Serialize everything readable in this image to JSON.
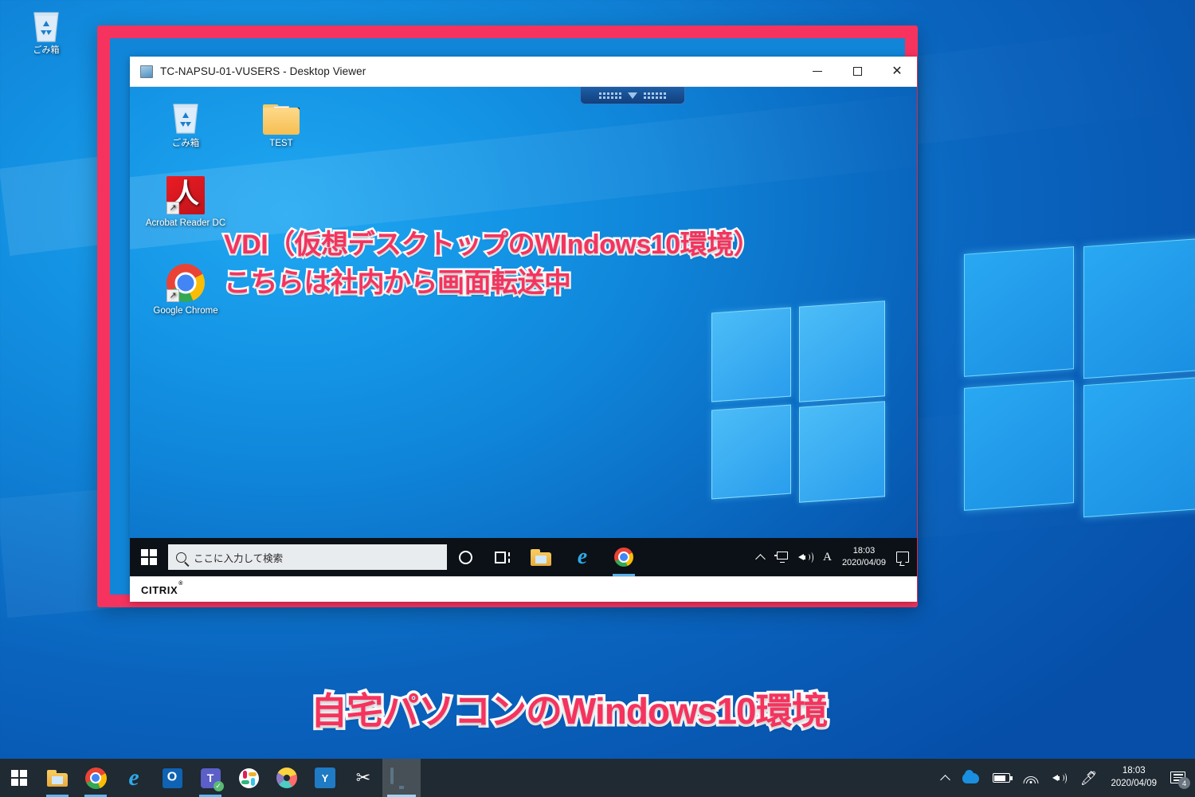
{
  "host": {
    "desktop_icons": [
      {
        "name": "recycle-bin",
        "label": "ごみ箱"
      }
    ],
    "annotation_bottom": "自宅パソコンのWindows10環境",
    "taskbar": {
      "start_label": "Start",
      "apps": [
        {
          "name": "file-explorer",
          "label": "エクスプローラー"
        },
        {
          "name": "google-chrome",
          "label": "Google Chrome"
        },
        {
          "name": "microsoft-edge",
          "label": "Microsoft Edge"
        },
        {
          "name": "microsoft-outlook",
          "label": "Outlook",
          "glyph": "O"
        },
        {
          "name": "microsoft-teams",
          "label": "Microsoft Teams",
          "glyph": "T",
          "badge": "✓"
        },
        {
          "name": "slack",
          "label": "Slack"
        },
        {
          "name": "paint-3d",
          "label": "ペイント 3D"
        },
        {
          "name": "yammer",
          "label": "Yammer",
          "glyph": "Y"
        },
        {
          "name": "snipping-tool",
          "label": "Snipping Tool",
          "glyph": "✂"
        },
        {
          "name": "remote-desktop",
          "label": "Desktop Viewer",
          "active": true
        }
      ],
      "tray": {
        "show_hidden": "︿",
        "onedrive": "OneDrive",
        "battery": "バッテリー",
        "wifi": "Wi-Fi",
        "volume": "音量",
        "pen": "ペン",
        "time": "18:03",
        "date": "2020/04/09",
        "notification_count": "4"
      }
    }
  },
  "vdi_window": {
    "title": "TC-NAPSU-01-VUSERS - Desktop Viewer",
    "controls": {
      "minimize": "−",
      "maximize": "□",
      "close": "✕"
    },
    "citrix_handle": "Desktop Viewer toolbar",
    "desktop_icons": [
      {
        "name": "recycle-bin",
        "label": "ごみ箱"
      },
      {
        "name": "test-folder",
        "label": "TEST"
      },
      {
        "name": "acrobat-reader",
        "label": "Acrobat Reader DC"
      },
      {
        "name": "google-chrome",
        "label": "Google Chrome"
      }
    ],
    "annotation_line1": "VDI（仮想デスクトップのWIndows10環境）",
    "annotation_line2": "こちらは社内から画面転送中",
    "taskbar": {
      "search_placeholder": "ここに入力して検索",
      "cortana": "Cortana",
      "task_view": "タスク ビュー",
      "apps": [
        {
          "name": "file-explorer",
          "label": "エクスプローラー"
        },
        {
          "name": "internet-explorer",
          "label": "Internet Explorer",
          "glyph": "e"
        },
        {
          "name": "google-chrome",
          "label": "Google Chrome",
          "active": true
        }
      ],
      "tray": {
        "show_hidden": "︿",
        "network": "ネットワーク",
        "volume": "音量",
        "ime": "A",
        "time": "18:03",
        "date": "2020/04/09",
        "action_center": "アクション センター"
      }
    },
    "status_bar": {
      "brand": "CITRIX",
      "trademark": "®"
    }
  },
  "colors": {
    "annotation_pink": "#f5335e",
    "frame_pink": "#f5335e",
    "frame_blue": "#1186d8",
    "desktop_blue": "#0f7fd4"
  }
}
